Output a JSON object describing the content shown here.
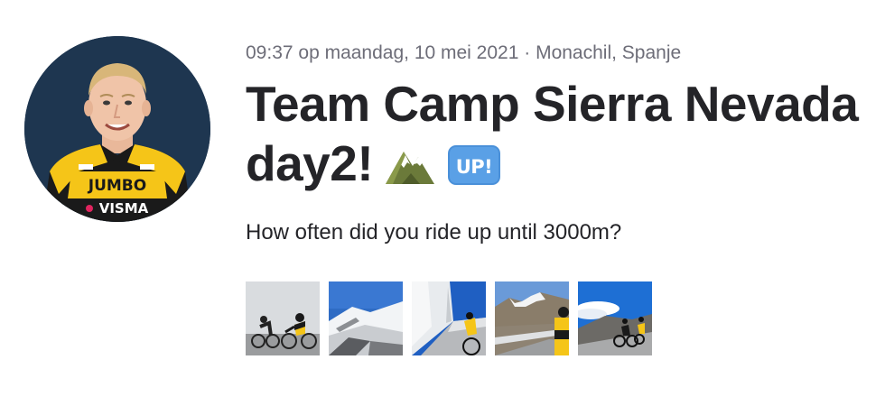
{
  "activity": {
    "datetime": "09:37 op maandag, 10 mei 2021",
    "separator": " · ",
    "location": "Monachil, Spanje",
    "title": "Team Camp Sierra Nevada day2!",
    "description": "How often did you ride up until 3000m?",
    "jersey_text_1": "JUMBO",
    "jersey_text_2": "VISMA",
    "title_icons": [
      "mountain-icon",
      "up-button-icon"
    ],
    "up_label": "UP!"
  },
  "photos": [
    {
      "name": "photo-1",
      "scene": "riders-in-fog"
    },
    {
      "name": "photo-2",
      "scene": "snowy-mountain-road"
    },
    {
      "name": "photo-3",
      "scene": "snow-wall-road"
    },
    {
      "name": "photo-4",
      "scene": "mountain-valley-rider"
    },
    {
      "name": "photo-5",
      "scene": "riders-blue-sky"
    }
  ],
  "colors": {
    "jersey_yellow": "#f5c518",
    "jersey_black": "#1a1a1a",
    "avatar_bg": "#1e3650",
    "meta_text": "#6d6d78",
    "title_text": "#242428",
    "up_badge": "#4a90d9"
  }
}
